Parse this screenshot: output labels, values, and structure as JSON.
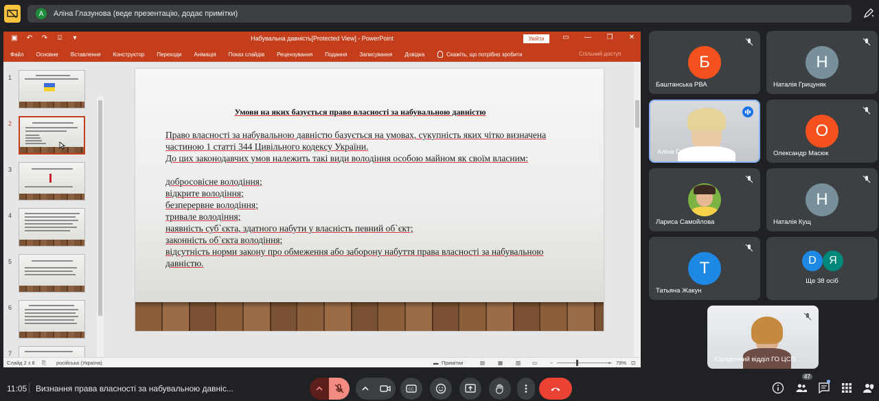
{
  "presenter_banner": {
    "avatar_letter": "А",
    "text": "Аліна Глазунова (веде презентацію, додає примітки)"
  },
  "ppt": {
    "title": "Набувальна давність[Protected View] - PowerPoint",
    "signin": "Увійти",
    "ribbon_tabs": [
      "Файл",
      "Основне",
      "Вставлення",
      "Конструктор",
      "Переходи",
      "Анімація",
      "Показ слайдів",
      "Рецензування",
      "Подання",
      "Записування",
      "Довідка"
    ],
    "tell_me": "Скажіть, що потрібно зробити",
    "share": "Спільний доступ",
    "thumbnails": [
      "1",
      "2",
      "3",
      "4",
      "5",
      "6",
      "7"
    ],
    "active_slide": 2,
    "slide": {
      "title": "Умови на яких базується право власності за набувальною давністю",
      "intro": [
        "Право власності за набувальною давністю базується на умовах, сукупність яких чітко визначена",
        "частиною 1 статті 344 Цивільного кодексу України.",
        "До цих законодавчих умов належить такі види володіння особою майном як своїм власним:"
      ],
      "items": [
        "добросовісне володіння;",
        "відкрите володіння;",
        "безперервне володіння;",
        "тривале володіння;",
        "наявність суб`єкта, здатного набути у власність певний об`єкт;",
        "законність об`єкта володіння;",
        "відсутність норми закону про обмеження або заборону набуття права власності за набувальною давністю."
      ]
    },
    "status": {
      "slide_counter": "Слайд 2 з 8",
      "language": "російська (Україна)",
      "notes": "Примітки",
      "zoom": "79%"
    }
  },
  "participants": [
    {
      "name": "Баштанська РВА",
      "letter": "Б",
      "color": "#f4511e"
    },
    {
      "name": "Наталія Грицуняк",
      "letter": "Н",
      "color": "#78909c"
    },
    {
      "name": "Аліна Глазунова",
      "letter": "",
      "color": ""
    },
    {
      "name": "Олександр Масюк",
      "letter": "О",
      "color": "#f4511e"
    },
    {
      "name": "Лариса Самойлова",
      "letter": "",
      "color": ""
    },
    {
      "name": "Наталія Кущ",
      "letter": "Н",
      "color": "#78909c"
    },
    {
      "name": "Татьяна Жакун",
      "letter": "Т",
      "color": "#1e88e5"
    },
    {
      "name": "Ще 38 осіб",
      "letter": "",
      "color": ""
    },
    {
      "name": "Юридичний відділ ГО ЦСП ...",
      "letter": "",
      "color": ""
    }
  ],
  "more_avatars": [
    {
      "letter": "D",
      "color": "#1e88e5"
    },
    {
      "letter": "Я",
      "color": "#00897b"
    }
  ],
  "bottom": {
    "time": "11:05",
    "meeting_title": "Визнання права власності за набувальною давніс...",
    "participant_count": "47"
  }
}
